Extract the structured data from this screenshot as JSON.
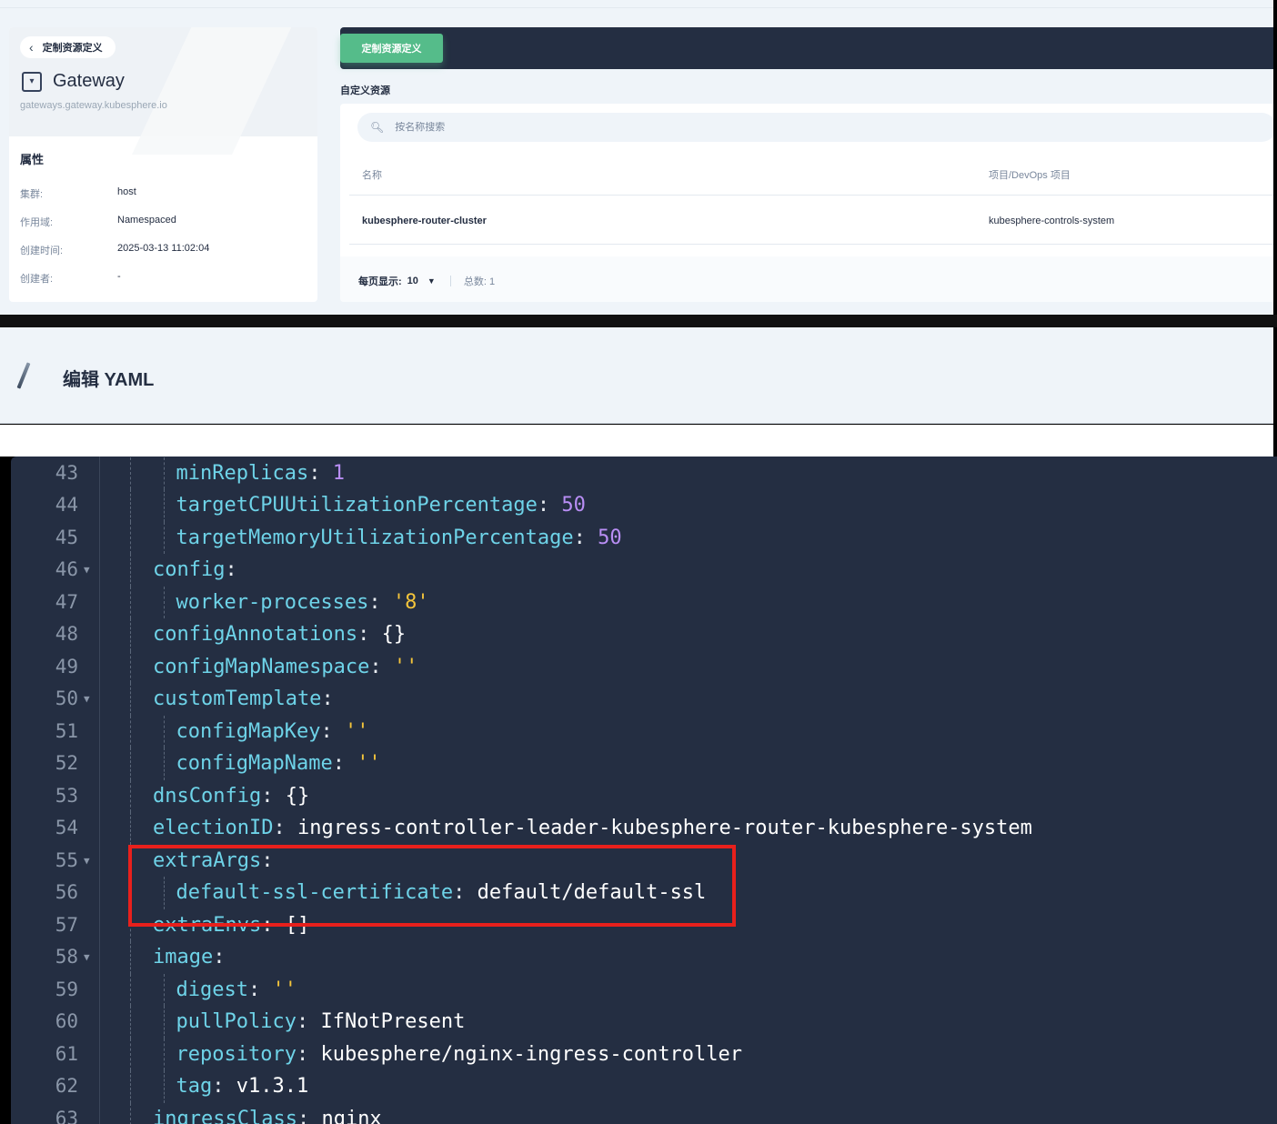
{
  "crd_panel": {
    "back_label": "定制资源定义",
    "resource_name": "Gateway",
    "resource_group": "gateways.gateway.kubesphere.io",
    "attributes_title": "属性",
    "attributes": [
      {
        "key": "集群:",
        "value": "host"
      },
      {
        "key": "作用域:",
        "value": "Namespaced"
      },
      {
        "key": "创建时间:",
        "value": "2025-03-13 11:02:04"
      },
      {
        "key": "创建者:",
        "value": "-"
      }
    ]
  },
  "resources": {
    "banner_button": "定制资源定义",
    "section_title": "自定义资源",
    "search_placeholder": "按名称搜索",
    "columns": {
      "name": "名称",
      "project": "项目/DevOps 项目"
    },
    "rows": [
      {
        "name": "kubesphere-router-cluster",
        "project": "kubesphere-controls-system"
      }
    ],
    "pagination": {
      "per_page_label": "每页显示:",
      "per_page_value": "10",
      "total_label": "总数: 1"
    }
  },
  "editor": {
    "title": "编辑 YAML",
    "lines": [
      {
        "n": "43",
        "fold": false,
        "indent": 1,
        "key": "minReplicas",
        "value": "1",
        "vtype": "num"
      },
      {
        "n": "44",
        "fold": false,
        "indent": 1,
        "key": "targetCPUUtilizationPercentage",
        "value": "50",
        "vtype": "num"
      },
      {
        "n": "45",
        "fold": false,
        "indent": 1,
        "key": "targetMemoryUtilizationPercentage",
        "value": "50",
        "vtype": "num"
      },
      {
        "n": "46",
        "fold": true,
        "indent": 0,
        "key": "config",
        "value": "",
        "vtype": "val"
      },
      {
        "n": "47",
        "fold": false,
        "indent": 1,
        "key": "worker-processes",
        "value": "'8'",
        "vtype": "str"
      },
      {
        "n": "48",
        "fold": false,
        "indent": 0,
        "key": "configAnnotations",
        "value": "{}",
        "vtype": "val"
      },
      {
        "n": "49",
        "fold": false,
        "indent": 0,
        "key": "configMapNamespace",
        "value": "''",
        "vtype": "str"
      },
      {
        "n": "50",
        "fold": true,
        "indent": 0,
        "key": "customTemplate",
        "value": "",
        "vtype": "val"
      },
      {
        "n": "51",
        "fold": false,
        "indent": 1,
        "key": "configMapKey",
        "value": "''",
        "vtype": "str"
      },
      {
        "n": "52",
        "fold": false,
        "indent": 1,
        "key": "configMapName",
        "value": "''",
        "vtype": "str"
      },
      {
        "n": "53",
        "fold": false,
        "indent": 0,
        "key": "dnsConfig",
        "value": "{}",
        "vtype": "val"
      },
      {
        "n": "54",
        "fold": false,
        "indent": 0,
        "key": "electionID",
        "value": "ingress-controller-leader-kubesphere-router-kubesphere-system",
        "vtype": "val"
      },
      {
        "n": "55",
        "fold": true,
        "indent": 0,
        "key": "extraArgs",
        "value": "",
        "vtype": "val"
      },
      {
        "n": "56",
        "fold": false,
        "indent": 1,
        "key": "default-ssl-certificate",
        "value": "default/default-ssl",
        "vtype": "val"
      },
      {
        "n": "57",
        "fold": false,
        "indent": 0,
        "key": "extraEnvs",
        "value": "[]",
        "vtype": "val"
      },
      {
        "n": "58",
        "fold": true,
        "indent": 0,
        "key": "image",
        "value": "",
        "vtype": "val"
      },
      {
        "n": "59",
        "fold": false,
        "indent": 1,
        "key": "digest",
        "value": "''",
        "vtype": "str"
      },
      {
        "n": "60",
        "fold": false,
        "indent": 1,
        "key": "pullPolicy",
        "value": "IfNotPresent",
        "vtype": "val"
      },
      {
        "n": "61",
        "fold": false,
        "indent": 1,
        "key": "repository",
        "value": "kubesphere/nginx-ingress-controller",
        "vtype": "val"
      },
      {
        "n": "62",
        "fold": false,
        "indent": 1,
        "key": "tag",
        "value": "v1.3.1",
        "vtype": "val"
      },
      {
        "n": "63",
        "fold": false,
        "indent": 0,
        "key": "ingressClass",
        "value": "nginx",
        "vtype": "val"
      }
    ]
  },
  "colors": {
    "accent_green": "#55bc8a",
    "editor_bg": "#242e42",
    "highlight_red": "#e8201c"
  }
}
